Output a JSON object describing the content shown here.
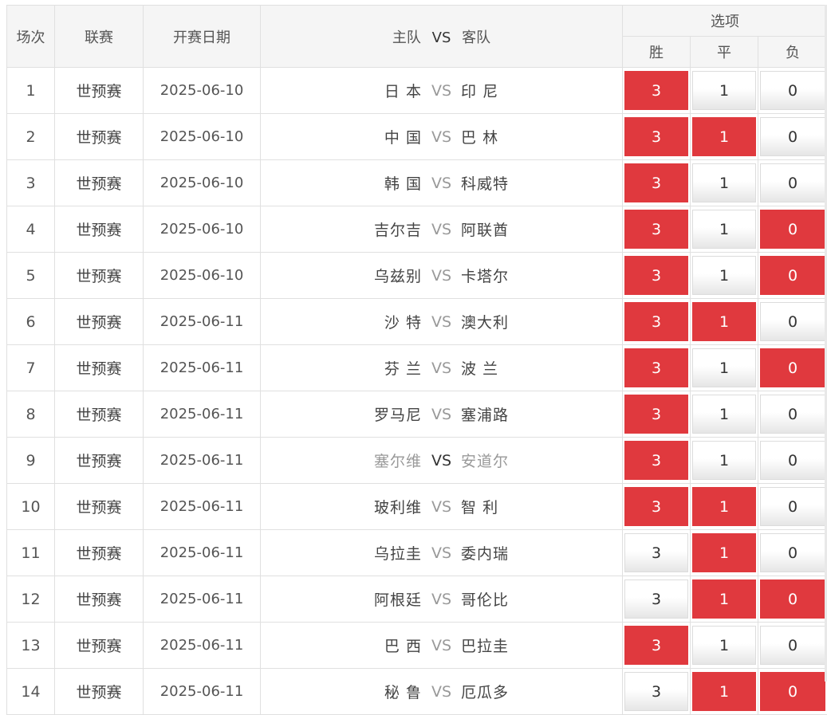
{
  "header": {
    "col_round": "场次",
    "col_league": "联赛",
    "col_date": "开赛日期",
    "col_home": "主队",
    "col_vs": "VS",
    "col_away": "客队",
    "col_options": "选项",
    "opt_win": "胜",
    "opt_draw": "平",
    "opt_loss": "负"
  },
  "colors": {
    "selected": "#e0393e",
    "unselected": "#ffffff"
  },
  "rows": [
    {
      "num": "1",
      "league": "世预赛",
      "date": "2025-06-10",
      "home": "日 本",
      "vs": "VS",
      "away": "印 尼",
      "win": "3",
      "draw": "1",
      "loss": "0",
      "sel": [
        true,
        false,
        false
      ],
      "muted": false
    },
    {
      "num": "2",
      "league": "世预赛",
      "date": "2025-06-10",
      "home": "中 国",
      "vs": "VS",
      "away": "巴 林",
      "win": "3",
      "draw": "1",
      "loss": "0",
      "sel": [
        true,
        true,
        false
      ],
      "muted": false
    },
    {
      "num": "3",
      "league": "世预赛",
      "date": "2025-06-10",
      "home": "韩 国",
      "vs": "VS",
      "away": "科威特",
      "win": "3",
      "draw": "1",
      "loss": "0",
      "sel": [
        true,
        false,
        false
      ],
      "muted": false
    },
    {
      "num": "4",
      "league": "世预赛",
      "date": "2025-06-10",
      "home": "吉尔吉",
      "vs": "VS",
      "away": "阿联酋",
      "win": "3",
      "draw": "1",
      "loss": "0",
      "sel": [
        true,
        false,
        true
      ],
      "muted": false
    },
    {
      "num": "5",
      "league": "世预赛",
      "date": "2025-06-10",
      "home": "乌兹别",
      "vs": "VS",
      "away": "卡塔尔",
      "win": "3",
      "draw": "1",
      "loss": "0",
      "sel": [
        true,
        false,
        true
      ],
      "muted": false
    },
    {
      "num": "6",
      "league": "世预赛",
      "date": "2025-06-11",
      "home": "沙 特",
      "vs": "VS",
      "away": "澳大利",
      "win": "3",
      "draw": "1",
      "loss": "0",
      "sel": [
        true,
        true,
        false
      ],
      "muted": false
    },
    {
      "num": "7",
      "league": "世预赛",
      "date": "2025-06-11",
      "home": "芬 兰",
      "vs": "VS",
      "away": "波 兰",
      "win": "3",
      "draw": "1",
      "loss": "0",
      "sel": [
        true,
        false,
        true
      ],
      "muted": false
    },
    {
      "num": "8",
      "league": "世预赛",
      "date": "2025-06-11",
      "home": "罗马尼",
      "vs": "VS",
      "away": "塞浦路",
      "win": "3",
      "draw": "1",
      "loss": "0",
      "sel": [
        true,
        false,
        false
      ],
      "muted": false
    },
    {
      "num": "9",
      "league": "世预赛",
      "date": "2025-06-11",
      "home": "塞尔维",
      "vs": "VS",
      "away": "安道尔",
      "win": "3",
      "draw": "1",
      "loss": "0",
      "sel": [
        true,
        false,
        false
      ],
      "muted": true
    },
    {
      "num": "10",
      "league": "世预赛",
      "date": "2025-06-11",
      "home": "玻利维",
      "vs": "VS",
      "away": "智 利",
      "win": "3",
      "draw": "1",
      "loss": "0",
      "sel": [
        true,
        true,
        false
      ],
      "muted": false
    },
    {
      "num": "11",
      "league": "世预赛",
      "date": "2025-06-11",
      "home": "乌拉圭",
      "vs": "VS",
      "away": "委内瑞",
      "win": "3",
      "draw": "1",
      "loss": "0",
      "sel": [
        false,
        true,
        false
      ],
      "muted": false
    },
    {
      "num": "12",
      "league": "世预赛",
      "date": "2025-06-11",
      "home": "阿根廷",
      "vs": "VS",
      "away": "哥伦比",
      "win": "3",
      "draw": "1",
      "loss": "0",
      "sel": [
        false,
        true,
        true
      ],
      "muted": false
    },
    {
      "num": "13",
      "league": "世预赛",
      "date": "2025-06-11",
      "home": "巴 西",
      "vs": "VS",
      "away": "巴拉圭",
      "win": "3",
      "draw": "1",
      "loss": "0",
      "sel": [
        true,
        false,
        false
      ],
      "muted": false
    },
    {
      "num": "14",
      "league": "世预赛",
      "date": "2025-06-11",
      "home": "秘 鲁",
      "vs": "VS",
      "away": "厄瓜多",
      "win": "3",
      "draw": "1",
      "loss": "0",
      "sel": [
        false,
        true,
        true
      ],
      "muted": false
    }
  ]
}
